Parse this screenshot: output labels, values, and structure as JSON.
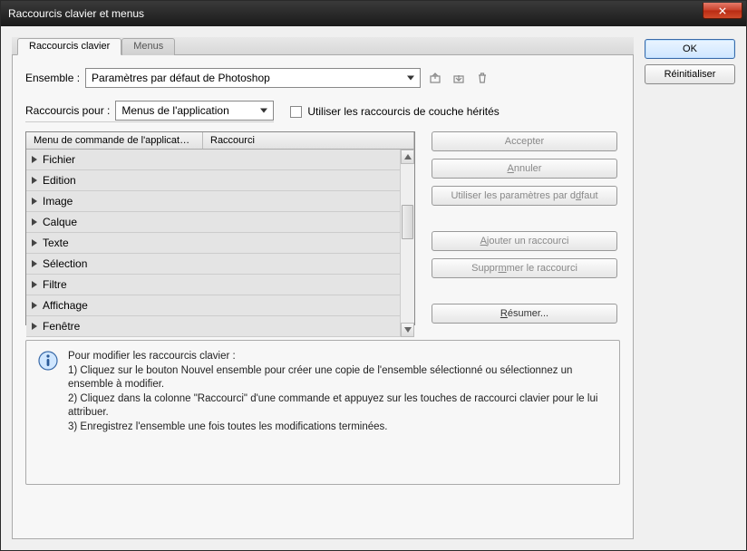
{
  "window": {
    "title": "Raccourcis clavier et menus"
  },
  "side": {
    "ok": "OK",
    "reset": "Réinitialiser"
  },
  "tabs": {
    "shortcuts": "Raccourcis clavier",
    "menus": "Menus"
  },
  "ensemble": {
    "label": "Ensemble :",
    "value": "Paramètres par défaut de Photoshop"
  },
  "shortcuts_for": {
    "label": "Raccourcis pour :",
    "value": "Menus de l'application",
    "legacy_checkbox": "Utiliser les raccourcis de couche hérités"
  },
  "list": {
    "col_menu": "Menu de commande de l'applicat…",
    "col_shortcut": "Raccourci",
    "rows": [
      "Fichier",
      "Edition",
      "Image",
      "Calque",
      "Texte",
      "Sélection",
      "Filtre",
      "Affichage",
      "Fenêtre"
    ]
  },
  "actions": {
    "accept": "Accepter",
    "undo": "Annuler",
    "use_default": "Utiliser les paramètres par défaut",
    "add": "Ajouter un raccourci",
    "delete": "Supprimer le raccourci",
    "summarize": "Résumer..."
  },
  "info": {
    "heading": "Pour modifier les raccourcis clavier :",
    "line1": "1) Cliquez sur le bouton Nouvel ensemble pour créer une copie de l'ensemble sélectionné ou sélectionnez un ensemble à modifier.",
    "line2": "2) Cliquez dans la colonne \"Raccourci\" d'une commande et appuyez sur les touches de raccourci clavier pour le lui attribuer.",
    "line3": "3) Enregistrez l'ensemble une fois toutes les modifications terminées."
  }
}
